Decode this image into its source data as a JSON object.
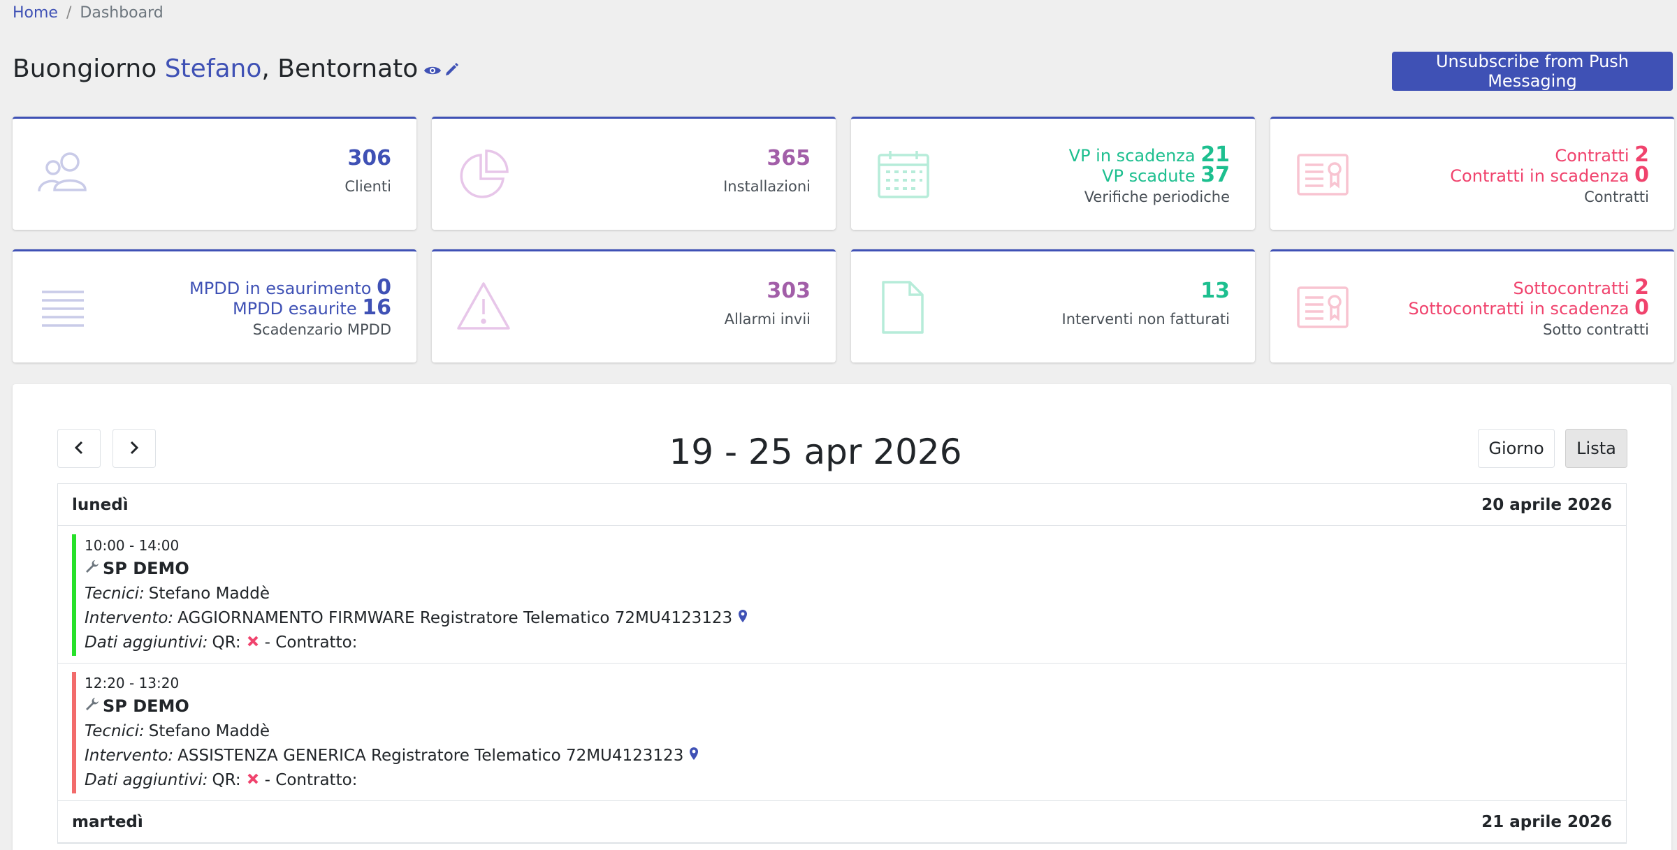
{
  "breadcrumb": {
    "home": "Home",
    "separator": "/",
    "current": "Dashboard"
  },
  "greeting": {
    "prefix": "Buongiorno",
    "name": "Stefano",
    "suffix": ", Bentornato"
  },
  "push_button": "Unsubscribe from Push Messaging",
  "colors": {
    "primary": "#3f51b5",
    "purple": "#a25ea8",
    "green": "#1dbf8f",
    "pink": "#f0436d",
    "event_green": "#27e12a",
    "event_red": "#f26b6b"
  },
  "cards": {
    "clienti": {
      "value": "306",
      "label": "Clienti",
      "icon": "users-icon"
    },
    "installazioni": {
      "value": "365",
      "label": "Installazioni",
      "icon": "pie-chart-icon"
    },
    "verifiche": {
      "vp_scadenza_label": "VP in scadenza",
      "vp_scadenza_value": "21",
      "vp_scadute_label": "VP scadute",
      "vp_scadute_value": "37",
      "label": "Verifiche periodiche",
      "icon": "calendar-icon"
    },
    "contratti": {
      "contratti_label": "Contratti",
      "contratti_value": "2",
      "scadenza_label": "Contratti in scadenza",
      "scadenza_value": "0",
      "label": "Contratti",
      "icon": "certificate-icon"
    },
    "mpdd": {
      "esaurimento_label": "MPDD in esaurimento",
      "esaurimento_value": "0",
      "esaurite_label": "MPDD esaurite",
      "esaurite_value": "16",
      "label": "Scadenzario MPDD",
      "icon": "list-lines-icon"
    },
    "allarmi": {
      "value": "303",
      "label": "Allarmi invii",
      "icon": "warning-icon"
    },
    "interventi": {
      "value": "13",
      "label": "Interventi non fatturati",
      "icon": "file-icon"
    },
    "sottocontratti": {
      "sotto_label": "Sottocontratti",
      "sotto_value": "2",
      "scadenza_label": "Sottocontratti in scadenza",
      "scadenza_value": "0",
      "label": "Sotto contratti",
      "icon": "certificate-icon"
    }
  },
  "calendar": {
    "title": "19 - 25 apr 2026",
    "view_day": "Giorno",
    "view_list": "Lista",
    "days": [
      {
        "weekday": "lunedì",
        "date": "20 aprile 2026",
        "events": [
          {
            "time": "10:00 - 14:00",
            "title": "SP DEMO",
            "tecnici_label": "Tecnici:",
            "tecnici": "Stefano Maddè",
            "intervento_label": "Intervento:",
            "intervento": "AGGIORNAMENTO FIRMWARE Registratore Telematico 72MU4123123",
            "dati_label": "Dati aggiuntivi:",
            "qr_label": "QR:",
            "contratto_label": "- Contratto:",
            "color": "#27e12a"
          },
          {
            "time": "12:20 - 13:20",
            "title": "SP DEMO",
            "tecnici_label": "Tecnici:",
            "tecnici": "Stefano Maddè",
            "intervento_label": "Intervento:",
            "intervento": "ASSISTENZA GENERICA Registratore Telematico 72MU4123123",
            "dati_label": "Dati aggiuntivi:",
            "qr_label": "QR:",
            "contratto_label": "- Contratto:",
            "color": "#f26b6b"
          }
        ]
      },
      {
        "weekday": "martedì",
        "date": "21 aprile 2026",
        "events": []
      }
    ]
  }
}
